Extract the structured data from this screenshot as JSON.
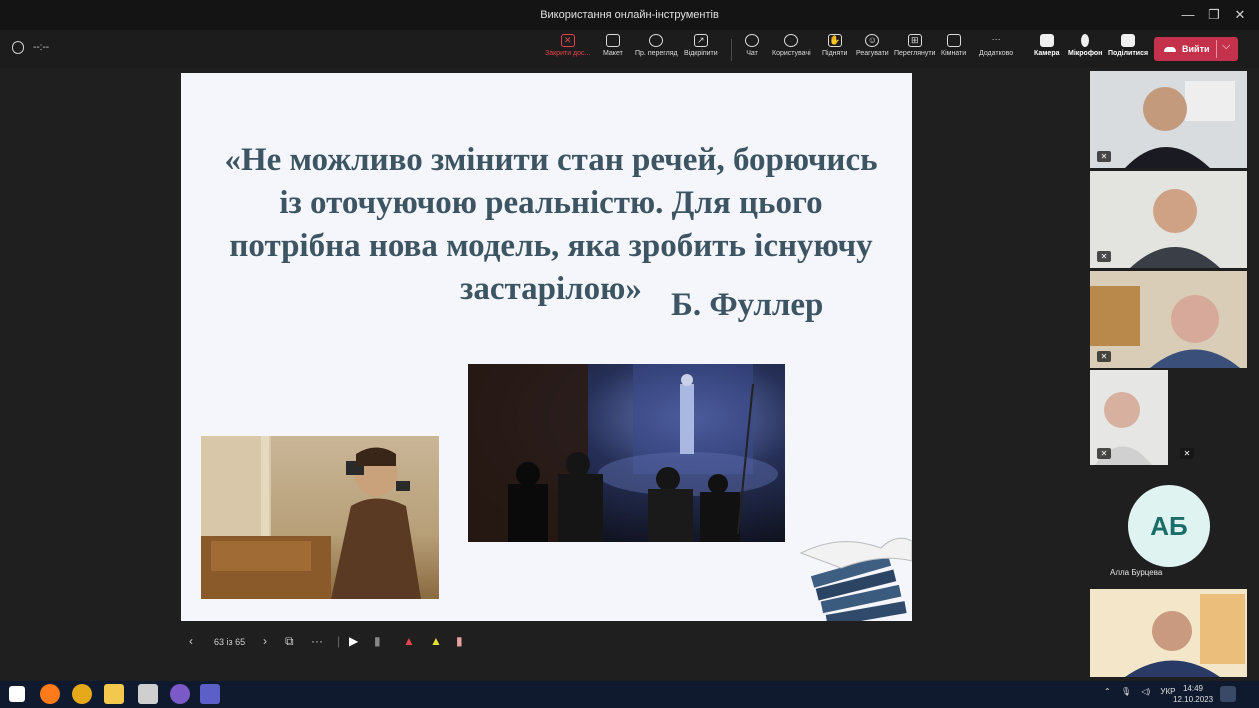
{
  "window": {
    "title": "Використання онлайн-інструментів"
  },
  "meeting": {
    "timer": "--:--"
  },
  "toolbar": {
    "close_share": "Закрити дос...",
    "layout": "Макет",
    "view": "Пр. перегляд",
    "pop_out": "Відкріпити",
    "chat": "Чат",
    "people": "Користувачі",
    "raise": "Підняти",
    "react": "Реагувати",
    "view2": "Переглянути",
    "rooms": "Кімнати",
    "more": "Додатково",
    "camera": "Камера",
    "mic": "Мікрофон",
    "share": "Поділитися",
    "leave": "Вийти"
  },
  "slide": {
    "quote": "«Не можливо змінити стан речей, борючись із оточуючою реальністю. Для цього потрібна нова модель, яка зробить існуючу застарілою»",
    "author": "Б. Фуллер"
  },
  "slide_nav": {
    "counter": "63 із 65"
  },
  "participants": [
    {
      "name": "participant-1"
    },
    {
      "name": "participant-2"
    },
    {
      "name": "participant-3"
    },
    {
      "name": "participant-4"
    }
  ],
  "avatar": {
    "initials": "АБ",
    "name": "Алла Бурцева"
  },
  "taskbar": {
    "lang": "УКР",
    "time": "14:49",
    "date": "12.10.2023"
  },
  "colors": {
    "leave": "#c4314b",
    "taskbar": "#0f1a2e",
    "quote_text": "#3d5563",
    "avatar_bg": "#dff3f1"
  }
}
